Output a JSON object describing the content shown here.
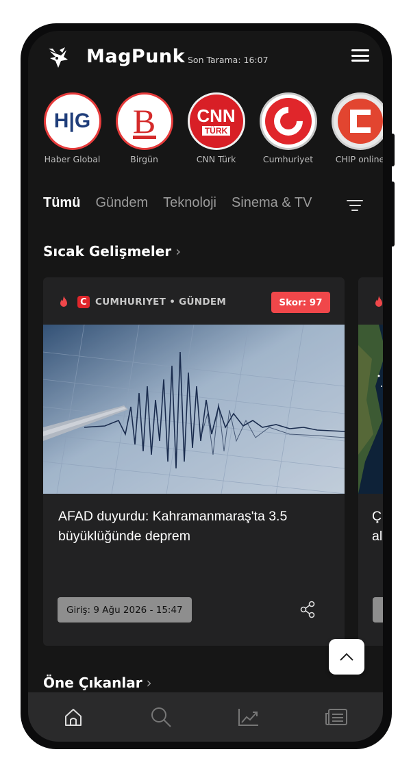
{
  "app": {
    "brand": "MagPunk",
    "last_scan": "Son Tarama: 16:07"
  },
  "sources": [
    {
      "name": "Haber Global"
    },
    {
      "name": "Birgün"
    },
    {
      "name": "CNN Türk"
    },
    {
      "name": "Cumhuriyet"
    },
    {
      "name": "CHIP online"
    }
  ],
  "source_logos": {
    "haber_global": "H|G",
    "birgun": "B",
    "cnn_top": "CNN",
    "cnn_bottom": "TÜRK"
  },
  "tabs": [
    {
      "label": "Tümü",
      "active": true
    },
    {
      "label": "Gündem"
    },
    {
      "label": "Teknoloji"
    },
    {
      "label": "Sinema & TV"
    }
  ],
  "sections": {
    "hot": "Sıcak Gelişmeler",
    "featured": "Öne Çıkanlar",
    "chevron": "›"
  },
  "cards": [
    {
      "source_category": "CUMHURIYET • GÜNDEM",
      "source_letter": "C",
      "score": "Skor: 97",
      "title": "AFAD duyurdu: Kahramanmaraş'ta 3.5 büyüklüğünde deprem",
      "date": "Giriş: 9 Ağu 2026 - 15:47",
      "image": "seismograph"
    },
    {
      "title_peek": "Ç\nal",
      "image": "satellite-map"
    }
  ],
  "icons": {
    "logo": "magpie-logo-icon",
    "menu": "hamburger-menu-icon",
    "filter": "filter-icon",
    "flame": "flame-icon",
    "share": "share-icon",
    "scroll_top": "chevron-up-icon",
    "nav": [
      "home-icon",
      "search-icon",
      "trending-icon",
      "news-icon"
    ]
  },
  "colors": {
    "background": "#161616",
    "card": "#222223",
    "accent_red": "#e63b3b",
    "score_bg": "#f0474a",
    "nav_bg": "#2a2a2b"
  }
}
